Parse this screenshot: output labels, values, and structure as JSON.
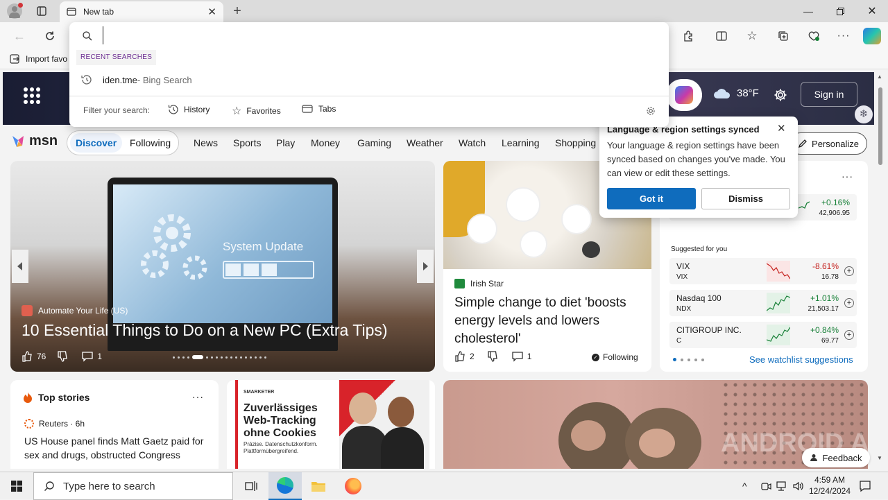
{
  "browser": {
    "tab_title": "New tab",
    "fav_import_label": "Import favo"
  },
  "omnibox": {
    "value": "",
    "recent_header": "RECENT SEARCHES",
    "recent_item": "iden.tme",
    "recent_item_suffix": " - Bing Search",
    "filter_label": "Filter your search:",
    "filters": [
      "History",
      "Favorites",
      "Tabs"
    ]
  },
  "msn_header": {
    "weather_temp": "38°F",
    "sign_in": "Sign in"
  },
  "msn_nav": {
    "logo": "msn",
    "pills": [
      "Discover",
      "Following"
    ],
    "tabs": [
      "News",
      "Sports",
      "Play",
      "Money",
      "Gaming",
      "Weather",
      "Watch",
      "Learning",
      "Shopping"
    ],
    "personalize": "Personalize"
  },
  "popup": {
    "title": "Language & region settings synced",
    "body": "Your language & region settings have been synced based on changes you've made. You can view or edit these settings.",
    "primary": "Got it",
    "secondary": "Dismiss"
  },
  "hero": {
    "source": "Automate Your Life (US)",
    "title": "10 Essential Things to Do on a New PC (Extra Tips)",
    "likes": "76",
    "comments": "1",
    "screen_text": "System Update"
  },
  "article2": {
    "source": "Irish Star",
    "title": "Simple change to diet 'boosts energy levels and lowers cholesterol'",
    "likes": "2",
    "comments": "1",
    "following": "Following"
  },
  "markets": {
    "top_row": {
      "change": "+0.16%",
      "value": "42,906.95"
    },
    "suggested_label": "Suggested for you",
    "rows": [
      {
        "name": "VIX",
        "ticker": "VIX",
        "change": "-8.61%",
        "value": "16.78",
        "dir": "down"
      },
      {
        "name": "Nasdaq 100",
        "ticker": "NDX",
        "change": "+1.01%",
        "value": "21,503.17",
        "dir": "up"
      },
      {
        "name": "CITIGROUP INC.",
        "ticker": "C",
        "change": "+0.84%",
        "value": "69.77",
        "dir": "up"
      }
    ],
    "see_more": "See watchlist suggestions"
  },
  "top_stories": {
    "title": "Top stories",
    "source": "Reuters · 6h",
    "headline": "US House panel finds Matt Gaetz paid for sex and drugs, obstructed Congress"
  },
  "ad": {
    "brand": "SMARKETER",
    "headline": "Zuverlässiges Web-Tracking ohne Cookies",
    "sub": "Präzise. Datenschutzkonform. Plattformübergreifend."
  },
  "feedback": "Feedback",
  "watermark": "ANDROID AUTHORITY",
  "taskbar": {
    "search_placeholder": "Type here to search",
    "time": "4:59 AM",
    "date": "12/24/2024"
  },
  "colors": {
    "accent": "#0f6cbd",
    "up": "#188038",
    "down": "#c5221f"
  }
}
